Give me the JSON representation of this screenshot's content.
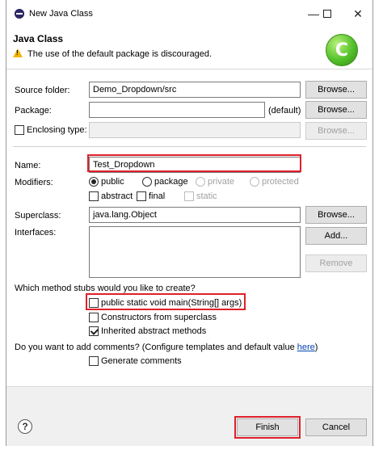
{
  "window": {
    "title": "New Java Class"
  },
  "header": {
    "title": "Java Class",
    "message": "The use of the default package is discouraged.",
    "logo_letter": "C"
  },
  "form": {
    "source_folder": {
      "label": "Source folder:",
      "value": "Demo_Dropdown/src",
      "browse": "Browse..."
    },
    "package": {
      "label": "Package:",
      "value": "",
      "suffix": "(default)",
      "browse": "Browse..."
    },
    "enclosing_type": {
      "label": "Enclosing type:",
      "value": "",
      "browse": "Browse..."
    },
    "name": {
      "label": "Name:",
      "value": "Test_Dropdown"
    },
    "modifiers": {
      "label": "Modifiers:",
      "public": "public",
      "package": "package",
      "private": "private",
      "protected": "protected",
      "abstract": "abstract",
      "final": "final",
      "static": "static"
    },
    "superclass": {
      "label": "Superclass:",
      "value": "java.lang.Object",
      "browse": "Browse..."
    },
    "interfaces": {
      "label": "Interfaces:",
      "add": "Add...",
      "remove": "Remove"
    },
    "stubs": {
      "question": "Which method stubs would you like to create?",
      "main": "public static void main(String[] args)",
      "constructors": "Constructors from superclass",
      "inherited": "Inherited abstract methods"
    },
    "comments": {
      "question": "Do you want to add comments? (Configure templates and default value ",
      "link": "here",
      "close": ")",
      "generate": "Generate comments"
    }
  },
  "footer": {
    "help": "?",
    "finish": "Finish",
    "cancel": "Cancel"
  },
  "icons": {
    "minimize": "minimize-icon",
    "maximize": "maximize-icon",
    "close": "close-icon",
    "warning": "warning-icon"
  },
  "colors": {
    "highlight": "#e0202b",
    "logo": "#53c12a"
  }
}
